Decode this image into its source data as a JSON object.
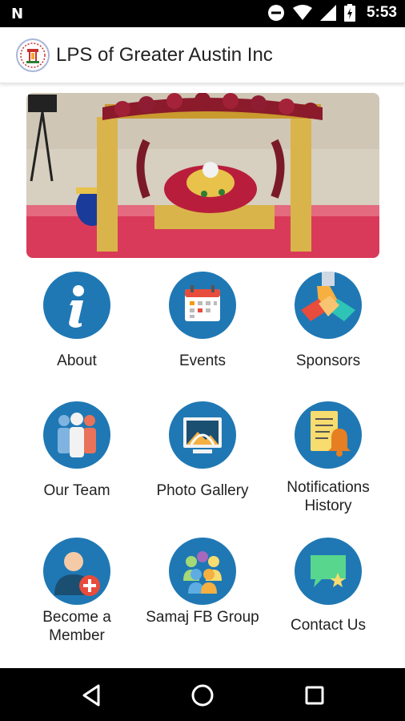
{
  "status_bar": {
    "notification_icon": "N",
    "time": "5:53",
    "icons": [
      "do-not-disturb-icon",
      "wifi-icon",
      "signal-icon",
      "battery-icon"
    ]
  },
  "app_bar": {
    "title": "LPS of Greater Austin Inc",
    "logo_icon": "lps-logo-icon"
  },
  "hero": {
    "image": "decorated-swing-photo"
  },
  "grid": [
    {
      "label": "About",
      "icon": "info-icon"
    },
    {
      "label": "Events",
      "icon": "calendar-icon"
    },
    {
      "label": "Sponsors",
      "icon": "handshake-icon"
    },
    {
      "label": "Our Team",
      "icon": "team-icon"
    },
    {
      "label": "Photo Gallery",
      "icon": "photo-gallery-icon"
    },
    {
      "label": "Notifications History",
      "icon": "notification-bell-icon"
    },
    {
      "label": "Become a Member",
      "icon": "add-member-icon"
    },
    {
      "label": "Samaj FB Group",
      "icon": "group-icon"
    },
    {
      "label": "Contact Us",
      "icon": "chat-icon"
    }
  ],
  "colors": {
    "icon_circle": "#1f78b4",
    "text": "#222222",
    "status_bar": "#000000"
  },
  "nav_bar": {
    "icons": [
      "back-icon",
      "home-icon",
      "recents-icon"
    ]
  }
}
